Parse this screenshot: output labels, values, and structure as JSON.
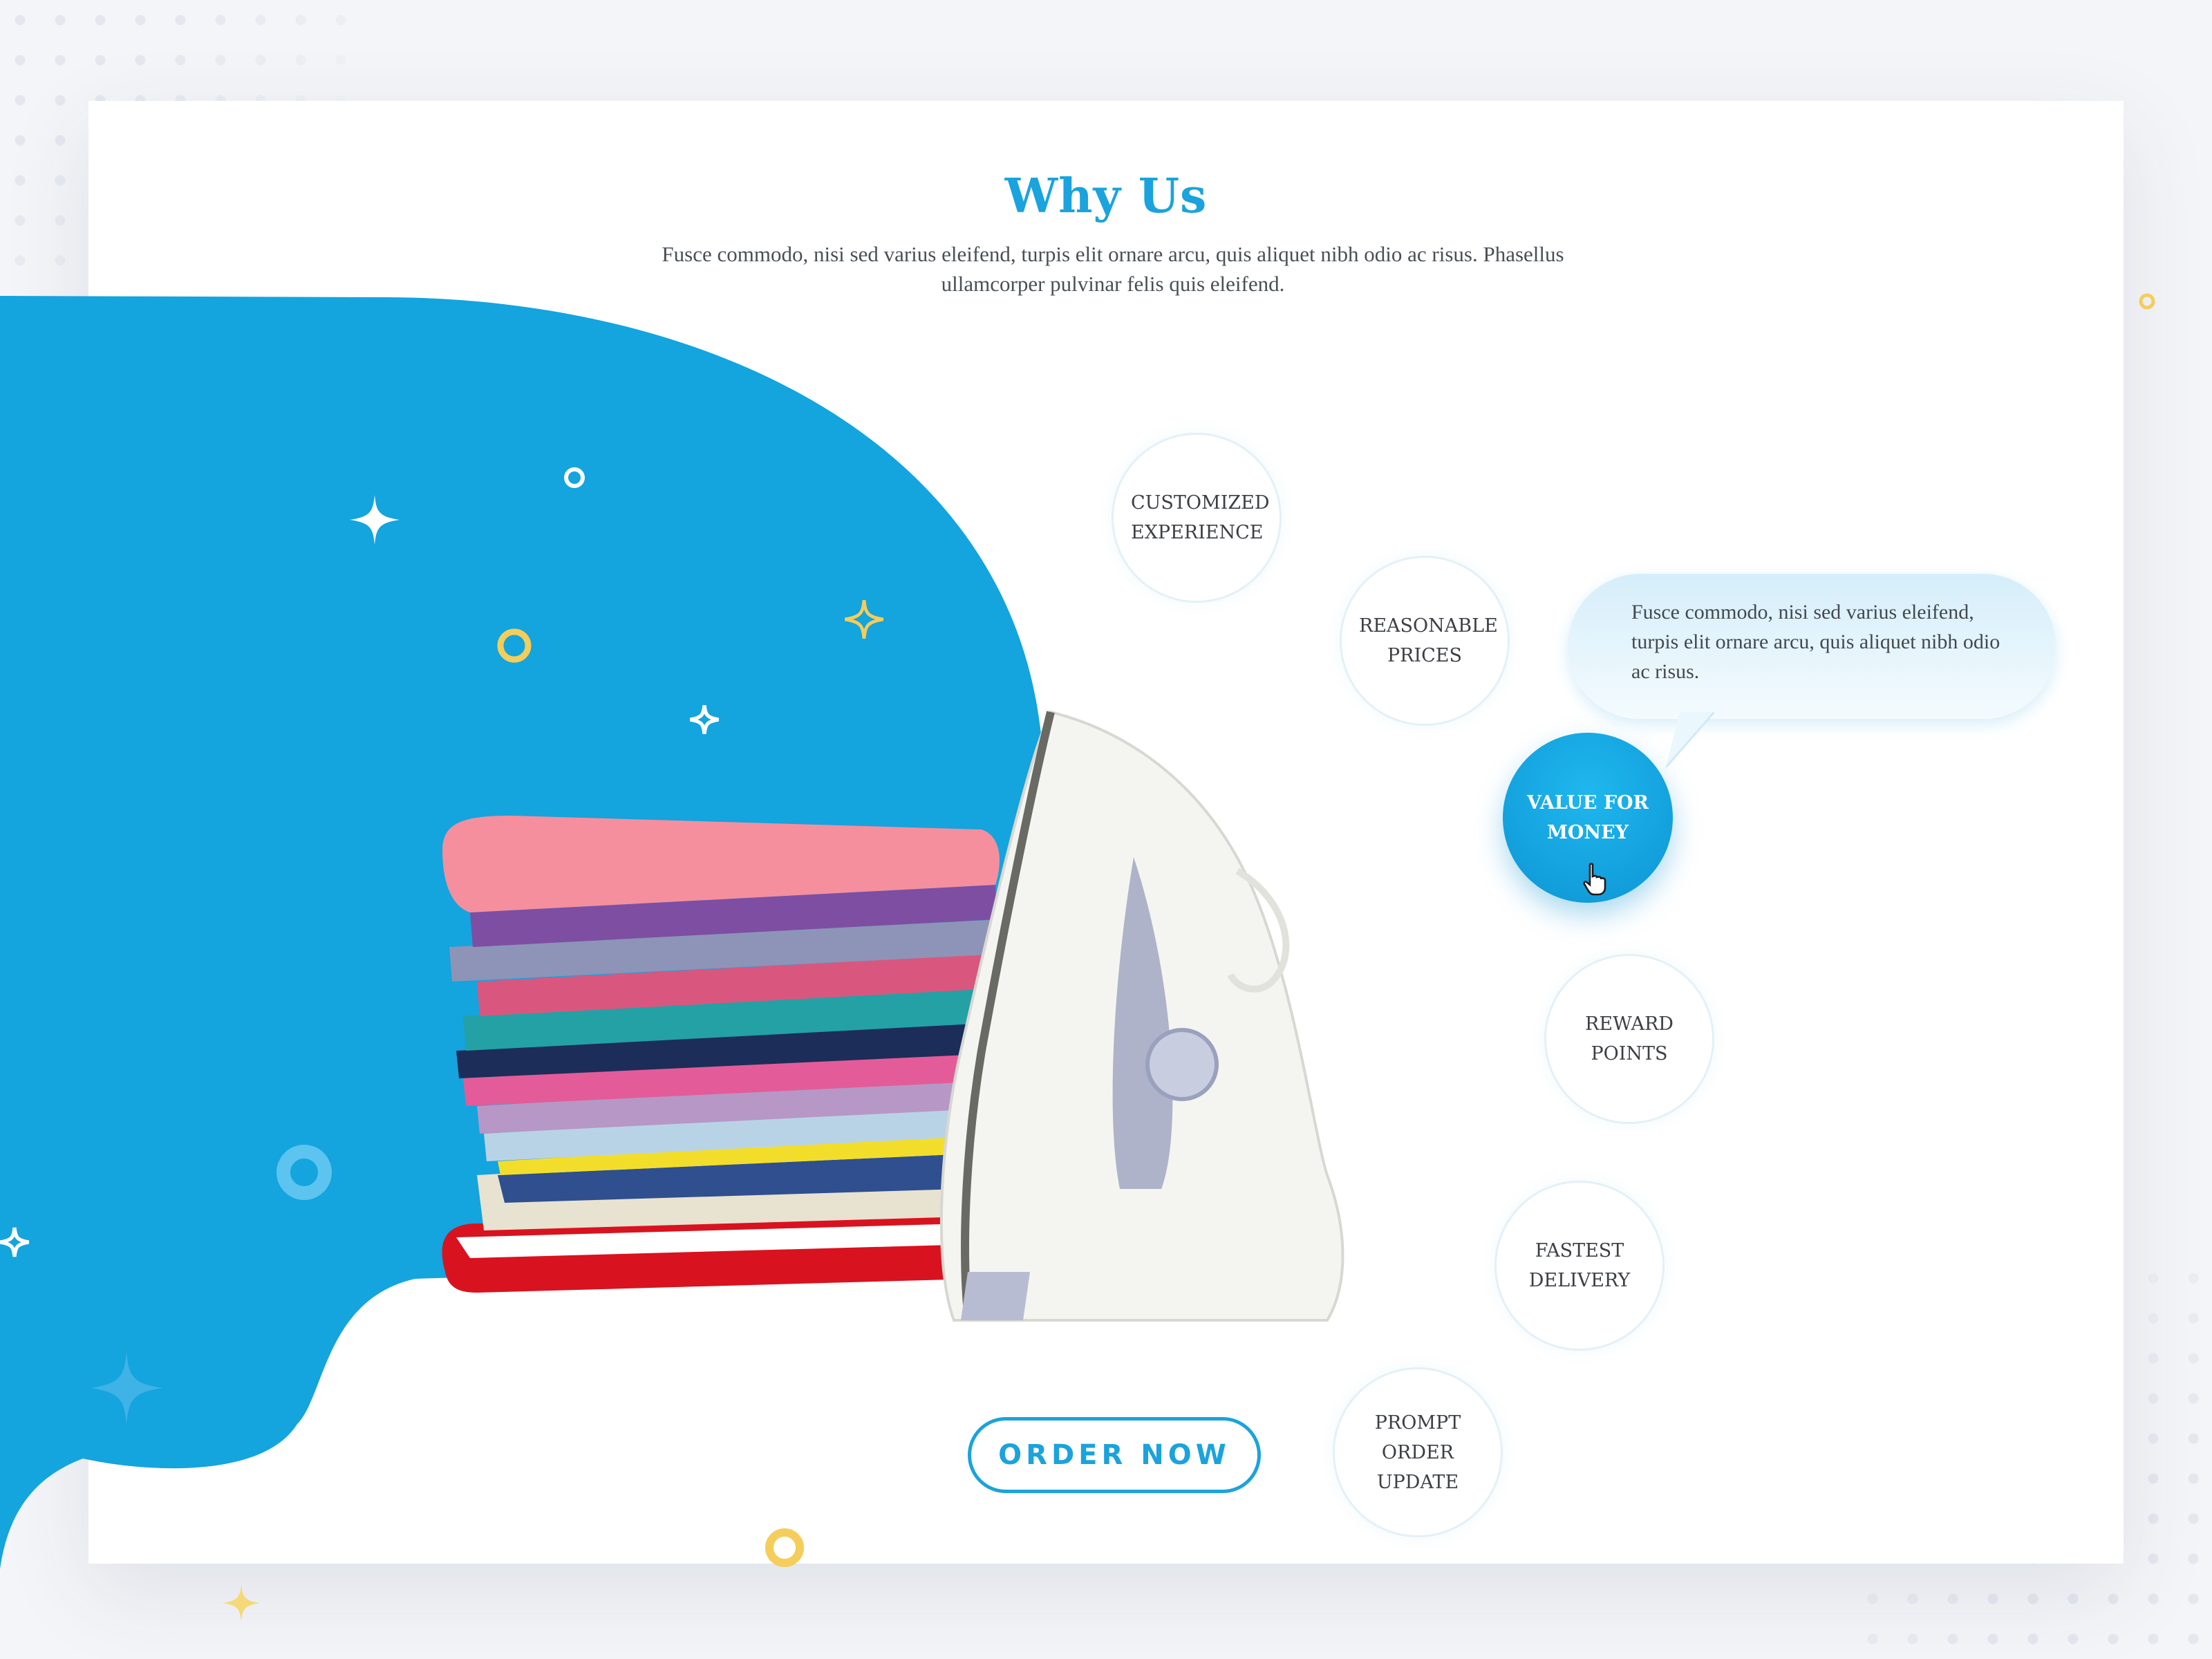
{
  "section": {
    "title": "Why Us",
    "intro": "Fusce commodo, nisi sed varius eleifend, turpis elit ornare arcu, quis aliquet nibh odio ac risus. Phasellus ullamcorper pulvinar felis quis eleifend."
  },
  "features": [
    {
      "label": "CUSTOMIZED EXPERIENCE",
      "active": false
    },
    {
      "label": "REASONABLE PRICES",
      "active": false
    },
    {
      "label": "VALUE FOR MONEY",
      "active": true
    },
    {
      "label": "REWARD POINTS",
      "active": false
    },
    {
      "label": "FASTEST DELIVERY",
      "active": false
    },
    {
      "label": "PROMPT ORDER UPDATE",
      "active": false
    }
  ],
  "tooltip": {
    "text": "Fusce commodo, nisi sed varius eleifend, turpis elit ornare arcu, quis aliquet nibh odio ac risus."
  },
  "cta": {
    "label": "ORDER NOW"
  },
  "icons": {
    "cursor": "hand-pointer-icon",
    "sparkle": "sparkle-icon",
    "ring": "ring-icon"
  },
  "colors": {
    "primary": "#1aa3dc",
    "accent_yellow": "#f5cd5a",
    "text": "#3c3f45",
    "background": "#f4f5f8"
  }
}
